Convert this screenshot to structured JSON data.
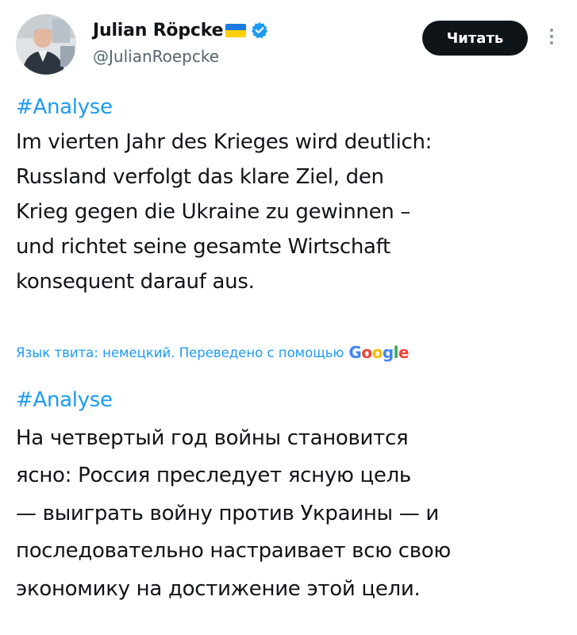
{
  "author": {
    "display_name": "Julian Röpcke",
    "handle": "@JulianRoepcke",
    "verified_icon": "verified-badge-icon",
    "flag_icon": "ukraine-flag-icon",
    "flag_colors": {
      "top": "#1b7ae0",
      "bottom": "#ffd000"
    }
  },
  "actions": {
    "follow_label": "Читать",
    "more_icon": "more-vertical-icon"
  },
  "tweet": {
    "hashtag": "#Analyse",
    "lines": [
      "Im vierten Jahr des Krieges wird deutlich:",
      "Russland verfolgt das klare Ziel, den",
      "Krieg gegen die Ukraine zu gewinnen –",
      "und richtet seine gesamte Wirtschaft",
      "konsequent darauf aus."
    ]
  },
  "translation": {
    "note": "Язык твита: немецкий. Переведено с помощью",
    "provider": "Google",
    "hashtag": "#Analyse",
    "lines": [
      "На четвертый год войны становится",
      "ясно: Россия преследует ясную цель",
      "— выиграть войну против Украины — и",
      "последовательно настраивает всю свою",
      "экономику на достижение этой цели."
    ]
  },
  "colors": {
    "accent": "#1d9bf0",
    "text": "#0f1419",
    "secondary": "#536471",
    "button_bg": "#0f1419"
  }
}
